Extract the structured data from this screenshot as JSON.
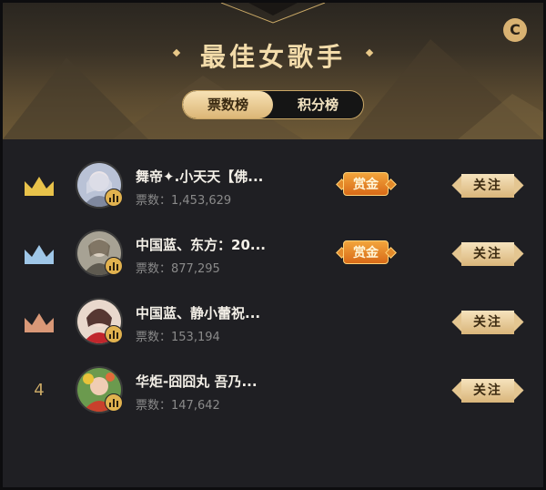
{
  "header": {
    "title": "最佳女歌手",
    "close_glyph": "C"
  },
  "tabs": [
    {
      "label": "票数榜",
      "active": true
    },
    {
      "label": "积分榜",
      "active": false
    }
  ],
  "ranking": [
    {
      "rank": 1,
      "rank_icon": "gold-crown-icon",
      "name": "舞帝✦.小天天【佛...",
      "votes_label": "票数：1,453,629",
      "bounty": "赏金",
      "follow": "关注"
    },
    {
      "rank": 2,
      "rank_icon": "silver-crown-icon",
      "name": "中国蓝、东方：20...",
      "votes_label": "票数：877,295",
      "bounty": "赏金",
      "follow": "关注"
    },
    {
      "rank": 3,
      "rank_icon": "bronze-crown-icon",
      "name": "中国蓝、静小蕾祝...",
      "votes_label": "票数：153,194",
      "bounty": "",
      "follow": "关注"
    },
    {
      "rank": 4,
      "rank_text": "4",
      "name": "华炬-囧囧丸 吾乃...",
      "votes_label": "票数：147,642",
      "bounty": "",
      "follow": "关注"
    }
  ],
  "colors": {
    "gold": "#e8c24a",
    "silver": "#9fc7e8",
    "bronze": "#d99877",
    "accent": "#d9b272"
  }
}
